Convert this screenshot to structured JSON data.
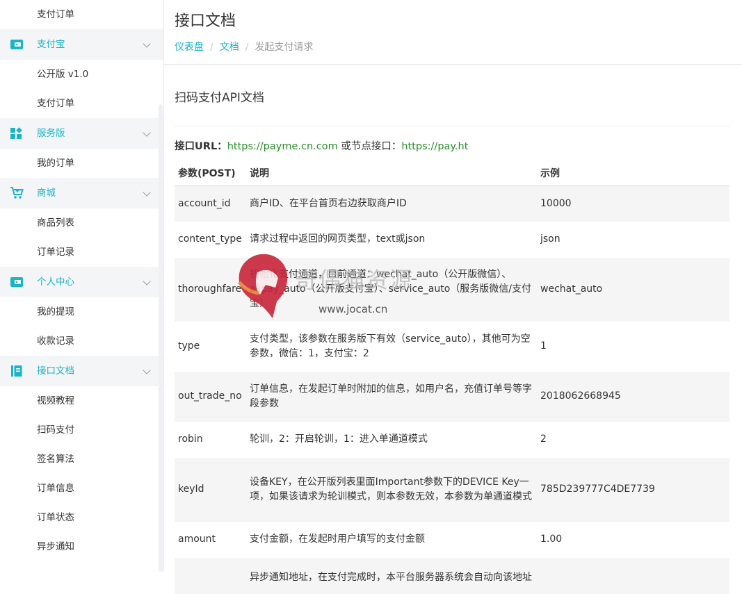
{
  "sidebar": {
    "top_item": "支付订单",
    "groups": [
      {
        "label": "支付宝",
        "icon": "wallet-icon",
        "items": [
          "公开版 v1.0",
          "支付订单"
        ]
      },
      {
        "label": "服务版",
        "icon": "apps-icon",
        "items": [
          "我的订单"
        ]
      },
      {
        "label": "商城",
        "icon": "cart-icon",
        "items": [
          "商品列表",
          "订单记录"
        ]
      },
      {
        "label": "个人中心",
        "icon": "wallet-icon",
        "items": [
          "我的提现",
          "收款记录"
        ]
      },
      {
        "label": "接口文档",
        "icon": "document-icon",
        "items": [
          "视频教程",
          "扫码支付",
          "签名算法",
          "订单信息",
          "订单状态",
          "异步通知"
        ]
      }
    ]
  },
  "header": {
    "title": "接口文档",
    "breadcrumb": [
      "仪表盘",
      "文档",
      "发起支付请求"
    ]
  },
  "doc": {
    "section_title": "扫码支付API文档",
    "api_url_label": "接口URL：",
    "api_url": "https://payme.cn.com",
    "node_label": " 或节点接口：",
    "node_url": "https://pay.ht",
    "columns": [
      "参数(POST)",
      "说明",
      "示例"
    ],
    "rows": [
      {
        "param": "account_id",
        "desc": "商户ID、在平台首页右边获取商户ID",
        "example": "10000"
      },
      {
        "param": "content_type",
        "desc": "请求过程中返回的网页类型，text或json",
        "example": "json"
      },
      {
        "param": "thoroughfare",
        "desc": "初始化支付通道，目前通道：wechat_auto（公开版微信）、alipay_auto（公开版支付宝）、service_auto（服务版微信/支付宝）",
        "example": "wechat_auto"
      },
      {
        "param": "type",
        "desc": "支付类型，该参数在服务版下有效（service_auto），其他可为空参数，微信：1，支付宝：2",
        "example": "1"
      },
      {
        "param": "out_trade_no",
        "desc": "订单信息，在发起订单时附加的信息，如用户名，充值订单号等字段参数",
        "example": "2018062668945"
      },
      {
        "param": "robin",
        "desc": "轮训，2：开启轮训，1：进入单通道模式",
        "example": "2"
      },
      {
        "param": "keyId",
        "desc": "设备KEY，在公开版列表里面Important参数下的DEVICE Key一项，如果该请求为轮训模式，则本参数无效，本参数为单通道模式",
        "example": "785D239777C4DE7739"
      },
      {
        "param": "amount",
        "desc": "支付金额，在发起时用户填写的支付金额",
        "example": "1.00"
      },
      {
        "param": "",
        "desc": "异步通知地址，在支付完成时，本平台服务器系统会自动向该地址",
        "example": ""
      }
    ]
  },
  "watermark": {
    "title": "奇偶猫资源",
    "url": "www.jocat.cn"
  }
}
